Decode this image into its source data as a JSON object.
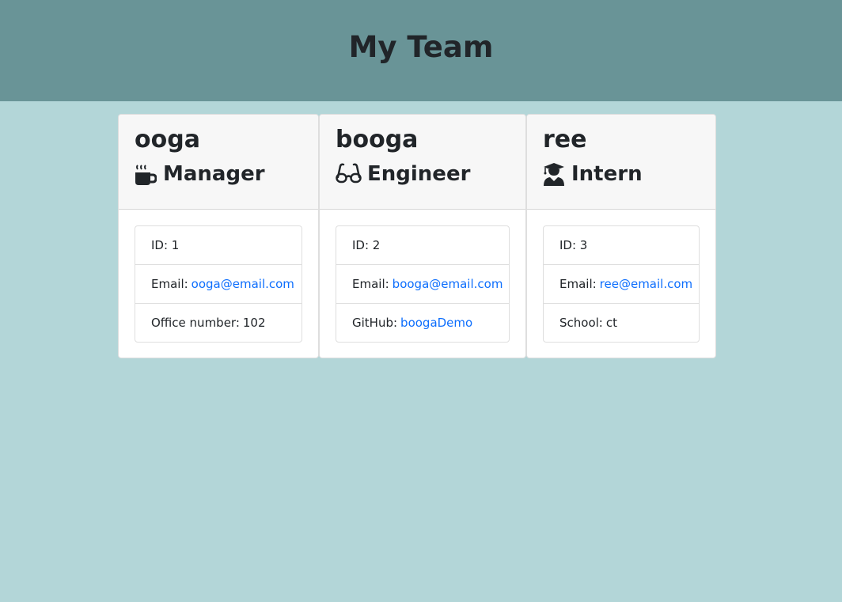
{
  "header": {
    "title": "My Team"
  },
  "cards": [
    {
      "name": "ooga",
      "role": "Manager",
      "role_icon": "mug-hot-icon",
      "id_text": "ID: 1",
      "email_label": "Email:",
      "email": "ooga@email.com",
      "extra_label": "Office number:",
      "extra_value": "102"
    },
    {
      "name": "booga",
      "role": "Engineer",
      "role_icon": "glasses-icon",
      "id_text": "ID: 2",
      "email_label": "Email:",
      "email": "booga@email.com",
      "extra_label": "GitHub:",
      "extra_value": "boogaDemo"
    },
    {
      "name": "ree",
      "role": "Intern",
      "role_icon": "user-graduate-icon",
      "id_text": "ID: 3",
      "email_label": "Email:",
      "email": "ree@email.com",
      "extra_label": "School:",
      "extra_value": "ct"
    }
  ],
  "colors": {
    "header_bg": "#699497",
    "page_bg": "#b3d6d8",
    "link": "#0d6efd"
  }
}
